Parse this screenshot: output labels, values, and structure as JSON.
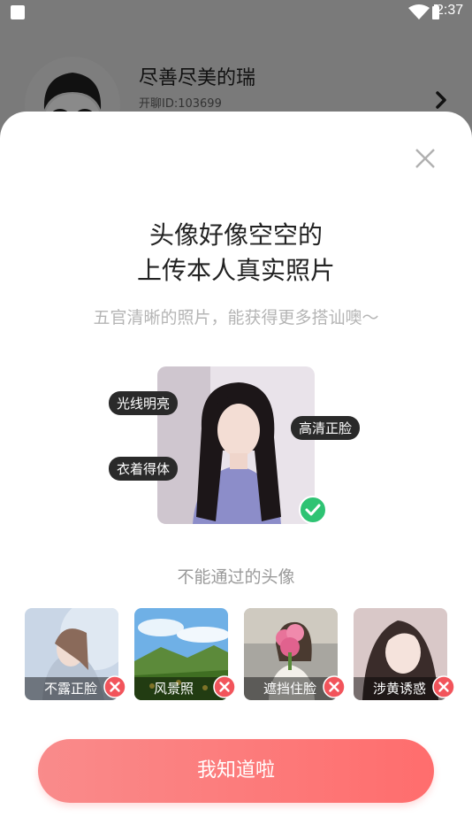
{
  "status": {
    "time": "2:37",
    "icons": [
      "square-notification-icon",
      "wifi-icon",
      "battery-icon"
    ]
  },
  "profile": {
    "name": "尽善尽美的瑞",
    "id_text": "开聊ID:103699"
  },
  "dialog": {
    "title_line1": "头像好像空空的",
    "title_line2": "上传本人真实照片",
    "subtitle": "五官清晰的照片，能获得更多搭讪噢〜",
    "good_tags": {
      "light": "光线明亮",
      "hd": "高清正脸",
      "dress": "衣着得体"
    },
    "bad_title": "不能通过的头像",
    "bad_examples": [
      {
        "label": "不露正脸"
      },
      {
        "label": "风景照"
      },
      {
        "label": "遮挡住脸"
      },
      {
        "label": "涉黄诱惑"
      }
    ],
    "confirm_label": "我知道啦"
  },
  "colors": {
    "accent_start": "#f98b8b",
    "accent_end": "#ff6d6d",
    "check_green": "#2ec373",
    "reject_red": "#f2545b"
  }
}
